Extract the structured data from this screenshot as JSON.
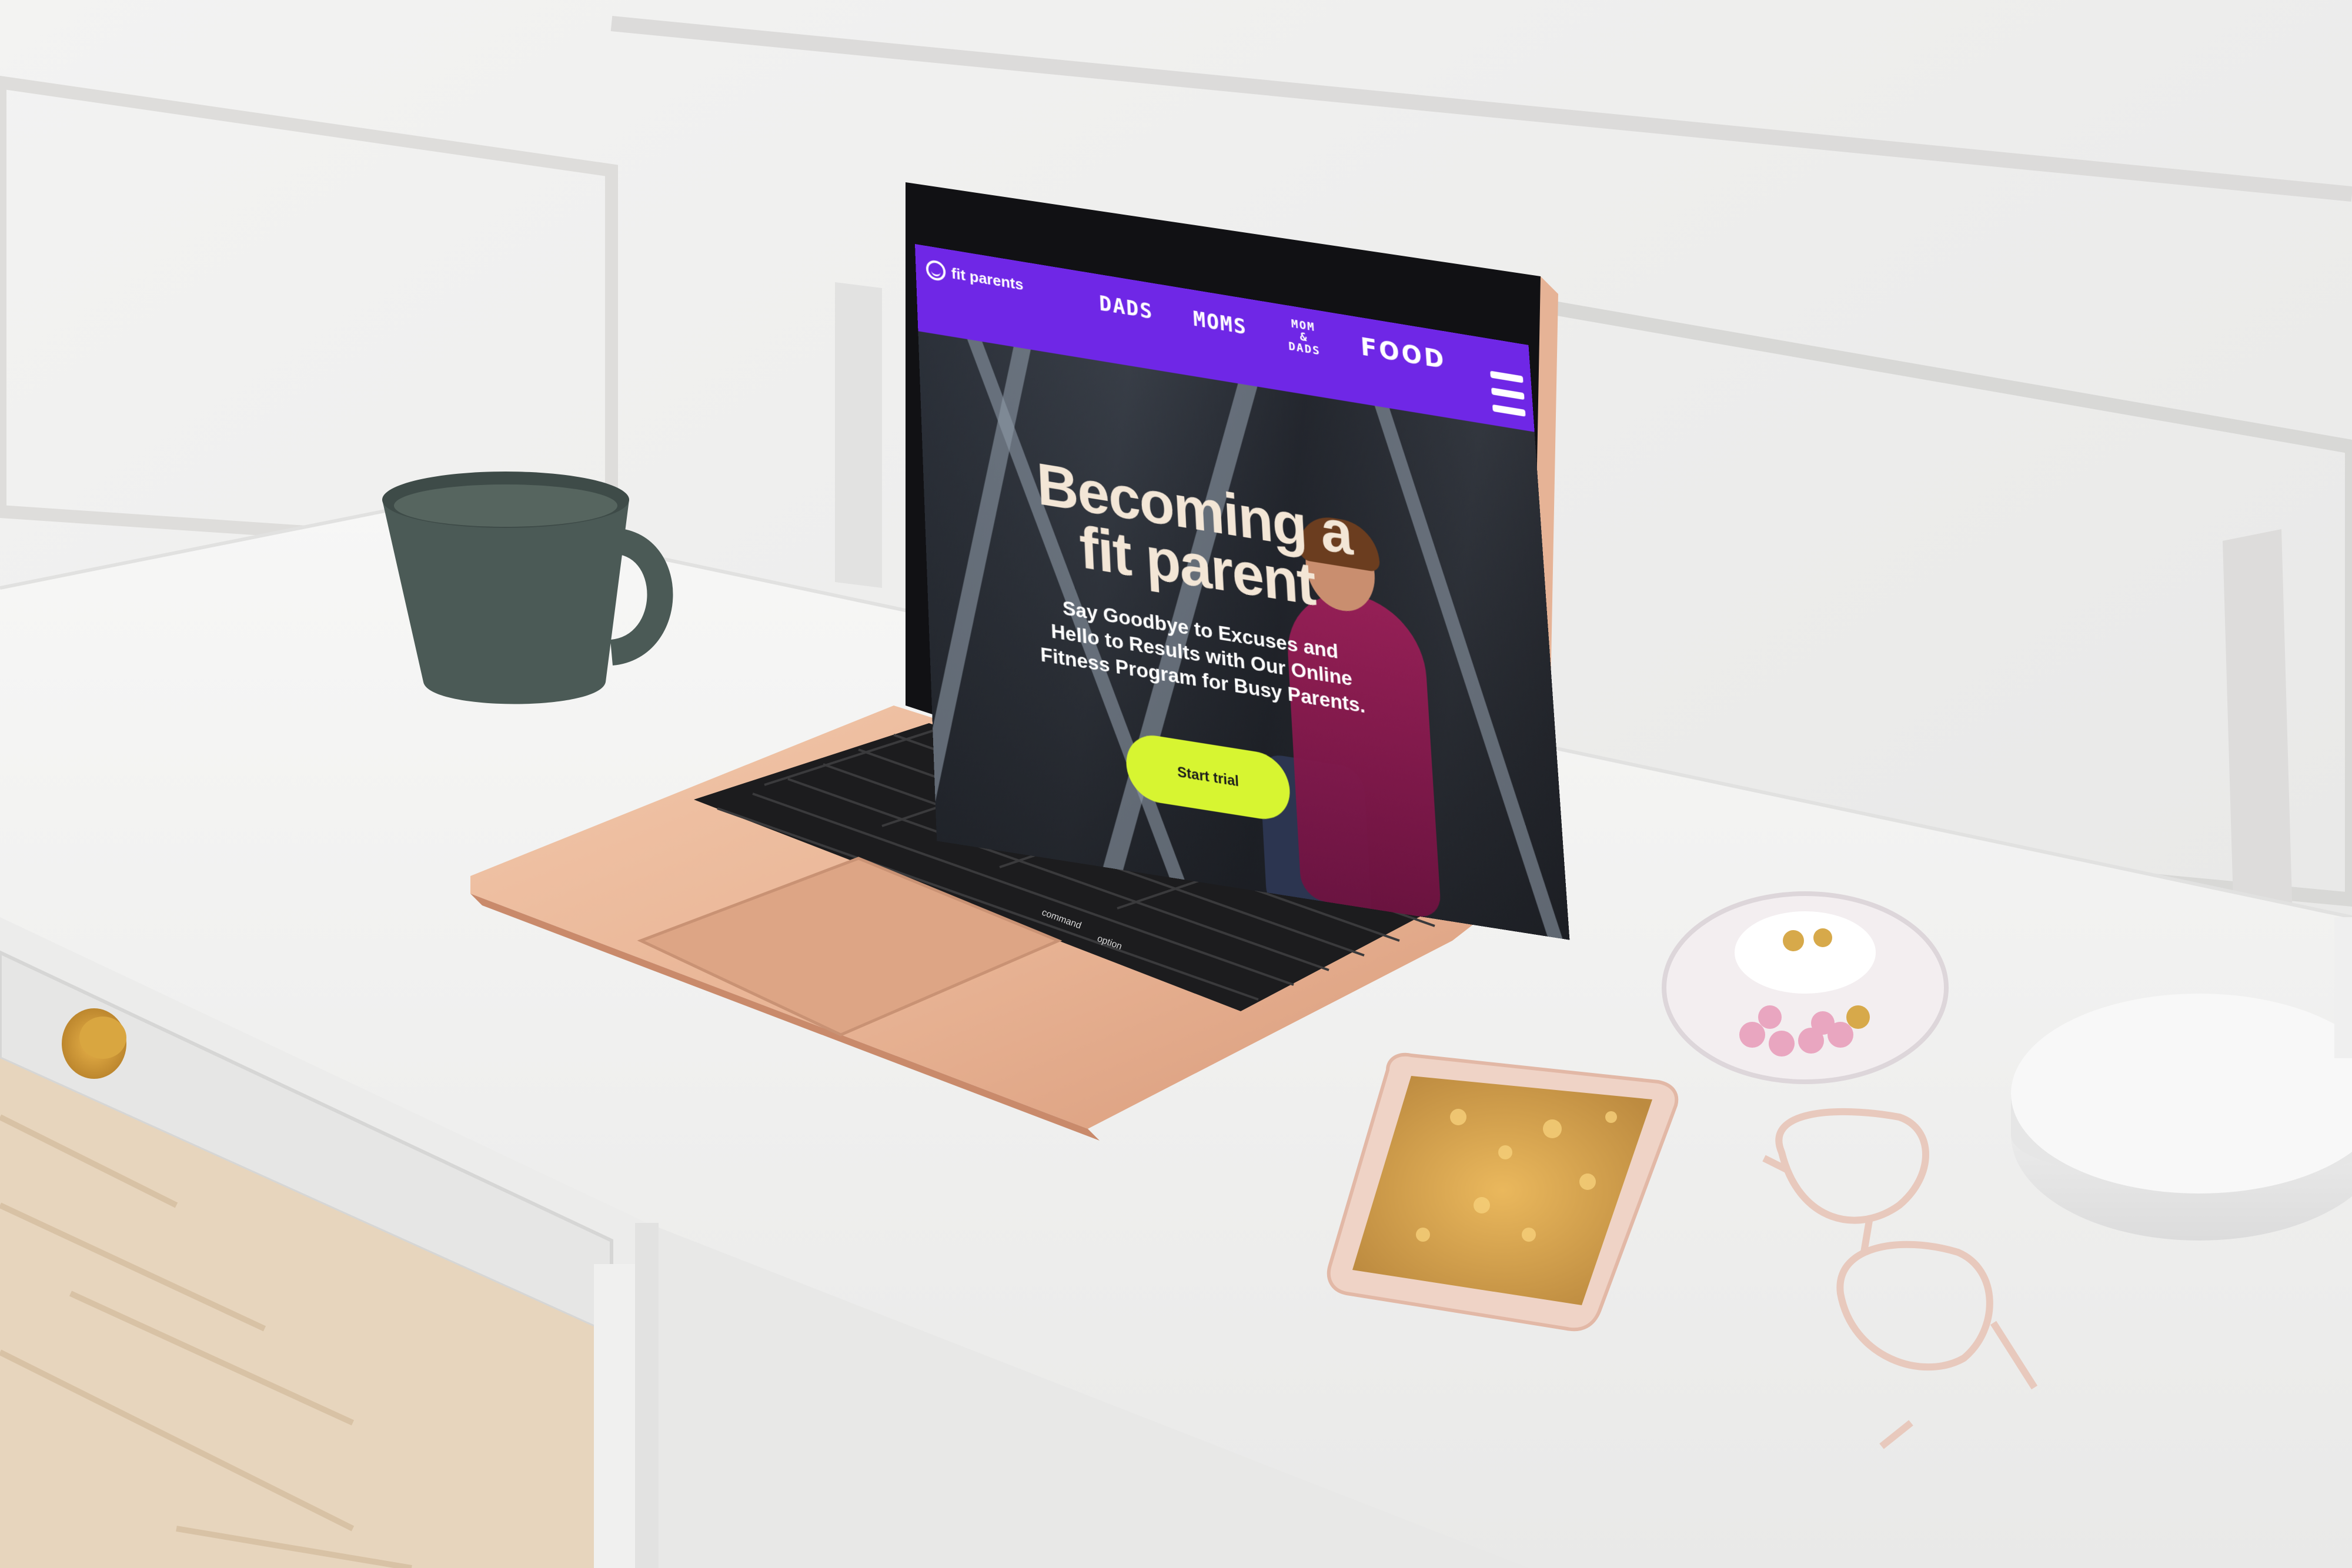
{
  "site": {
    "logo_text": "fit parents",
    "nav": [
      {
        "label": "DADS"
      },
      {
        "label": "MOMS"
      },
      {
        "label": "MOM & DADS"
      },
      {
        "label": "FOOD"
      }
    ],
    "hero": {
      "title": "Becoming a fit parent",
      "subtitle": "Say Goodbye to Excuses and Hello to Results with Our Online Fitness Program for Busy Parents.",
      "cta_label": "Start trial"
    }
  },
  "keyboard": {
    "command_label": "command",
    "option_label": "option"
  },
  "colors": {
    "brand": "#6f27e6",
    "cta": "#d7f531",
    "title": "#f3e6d6",
    "laptop": "#e9b596",
    "desk": "#f4f4f3",
    "mug": "#4b5a56"
  },
  "icons": [
    "smile-logo-icon",
    "hamburger-menu-icon"
  ]
}
